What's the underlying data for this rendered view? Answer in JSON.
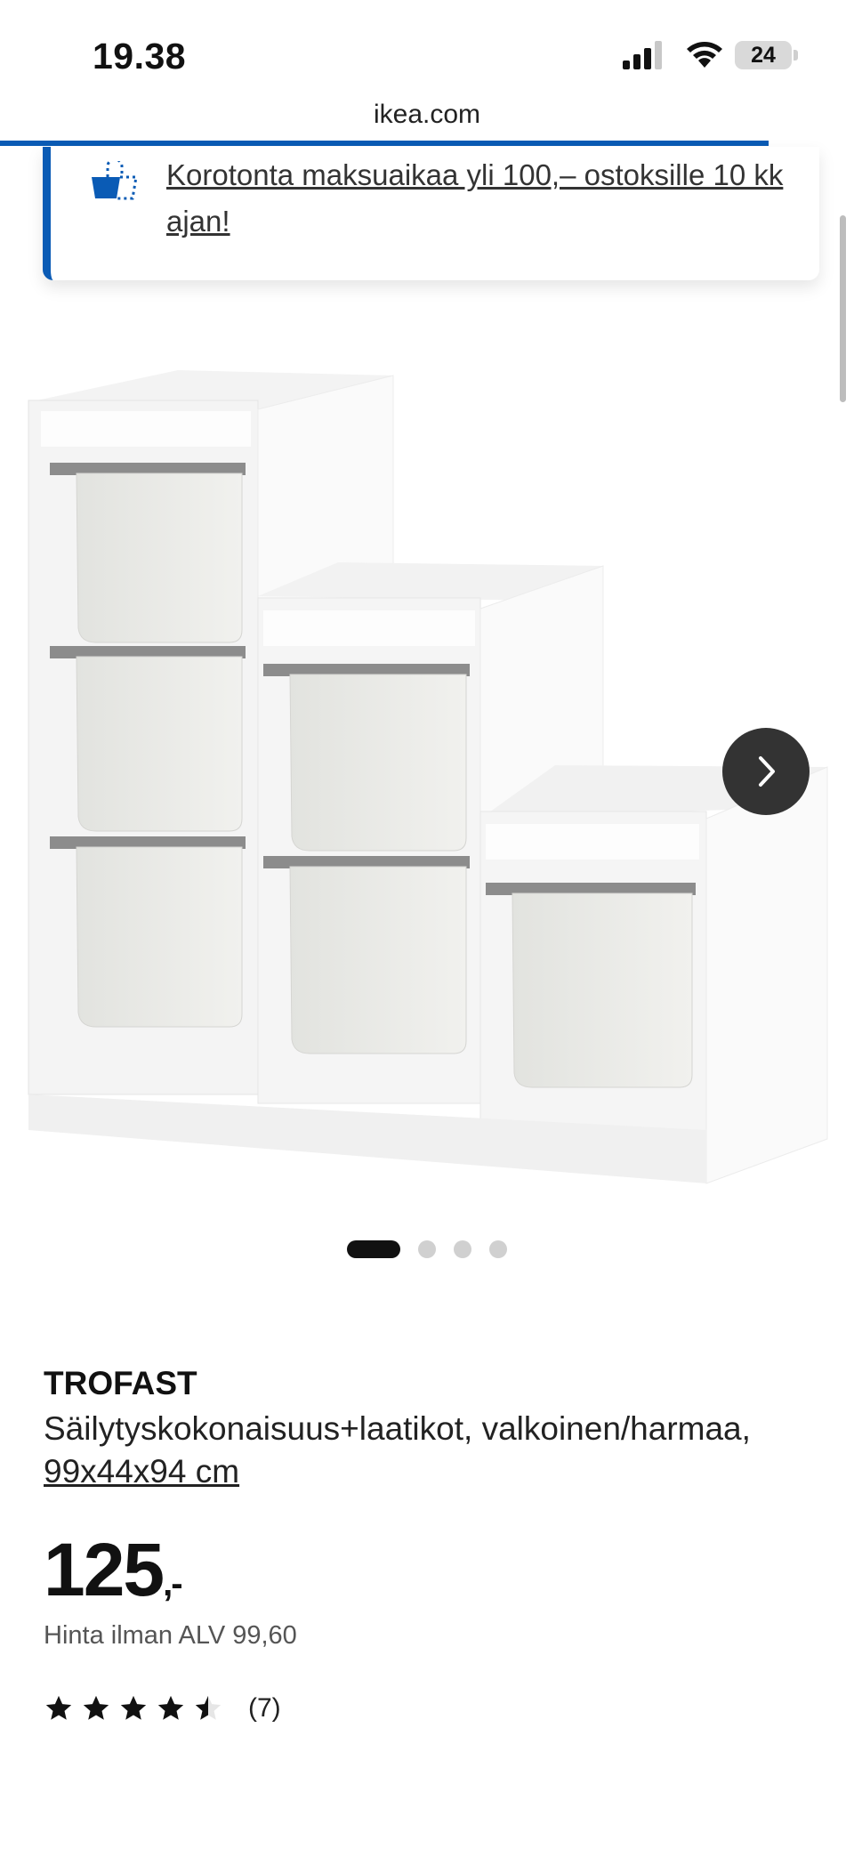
{
  "status_bar": {
    "time": "19.38",
    "battery": "24"
  },
  "browser": {
    "url": "ikea.com",
    "progress": 0.9
  },
  "promo": {
    "text": "Korotonta maksuaikaa yli 100,– ostoksille 10 kk ajan!",
    "icon": "payment-basket-icon",
    "accent": "#0a5bb5"
  },
  "gallery": {
    "image_count": 4,
    "active_index": 0
  },
  "product": {
    "name": "TROFAST",
    "description": "Säilytyskokonaisuus+laatikot, valkoinen/harmaa,",
    "dimensions": "99x44x94 cm",
    "price": "125",
    "price_suffix": ",-",
    "vat_note": "Hinta ilman ALV 99,60",
    "rating": 4.5,
    "review_count": "(7)"
  }
}
